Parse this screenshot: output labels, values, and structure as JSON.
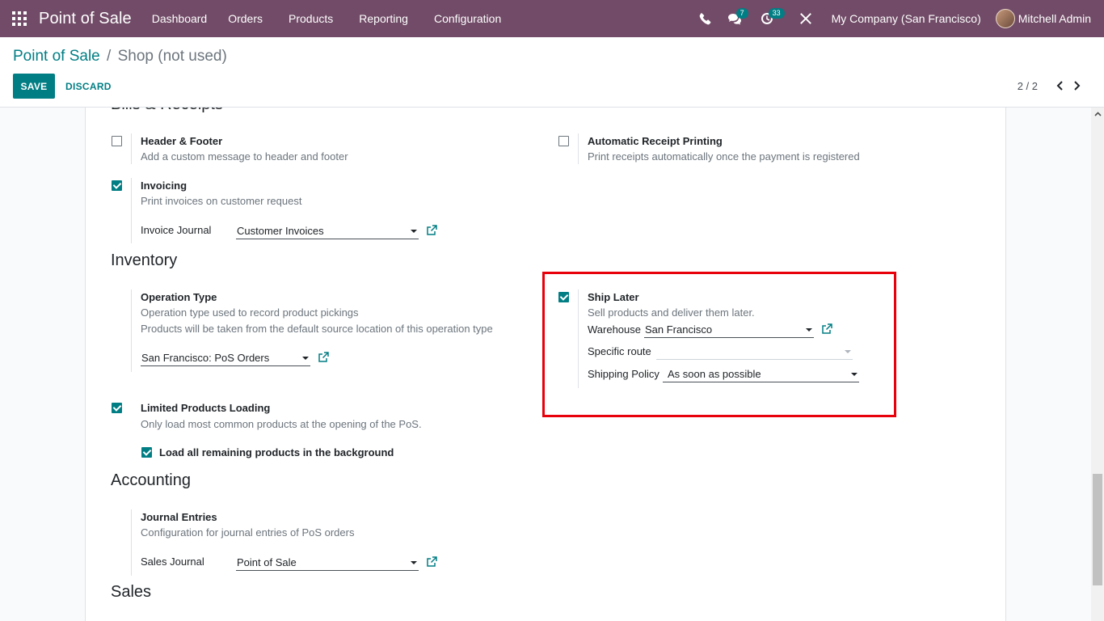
{
  "navbar": {
    "brand": "Point of Sale",
    "menu": [
      "Dashboard",
      "Orders",
      "Products",
      "Reporting",
      "Configuration"
    ],
    "messages_count": "7",
    "activities_count": "33",
    "company": "My Company (San Francisco)",
    "user": "Mitchell Admin"
  },
  "breadcrumb": {
    "parent": "Point of Sale",
    "separator": "/",
    "current": "Shop (not used)"
  },
  "buttons": {
    "save": "SAVE",
    "discard": "DISCARD"
  },
  "pager": {
    "value": "2 / 2"
  },
  "sections": {
    "bills": "Bills & Receipts",
    "inventory": "Inventory",
    "accounting": "Accounting",
    "sales": "Sales"
  },
  "settings": {
    "header_footer": {
      "title": "Header & Footer",
      "desc": "Add a custom message to header and footer",
      "checked": false
    },
    "auto_receipt": {
      "title": "Automatic Receipt Printing",
      "desc": "Print receipts automatically once the payment is registered",
      "checked": false
    },
    "invoicing": {
      "title": "Invoicing",
      "desc": "Print invoices on customer request",
      "checked": true,
      "journal_label": "Invoice Journal",
      "journal_value": "Customer Invoices"
    },
    "operation_type": {
      "title": "Operation Type",
      "desc1": "Operation type used to record product pickings",
      "desc2": "Products will be taken from the default source location of this operation type",
      "value": "San Francisco: PoS Orders"
    },
    "ship_later": {
      "title": "Ship Later",
      "desc": "Sell products and deliver them later.",
      "checked": true,
      "warehouse_label": "Warehouse",
      "warehouse_value": "San Francisco",
      "route_label": "Specific route",
      "route_value": "",
      "policy_label": "Shipping Policy",
      "policy_value": "As soon as possible"
    },
    "limited_products": {
      "title": "Limited Products Loading",
      "desc": "Only load most common products at the opening of the PoS.",
      "checked": true,
      "sub_label": "Load all remaining products in the background",
      "sub_checked": true
    },
    "journal_entries": {
      "title": "Journal Entries",
      "desc": "Configuration for journal entries of PoS orders",
      "sales_journal_label": "Sales Journal",
      "sales_journal_value": "Point of Sale"
    }
  },
  "colors": {
    "navbar": "#714B67",
    "accent": "#017E84",
    "highlight": "#e8000b"
  }
}
